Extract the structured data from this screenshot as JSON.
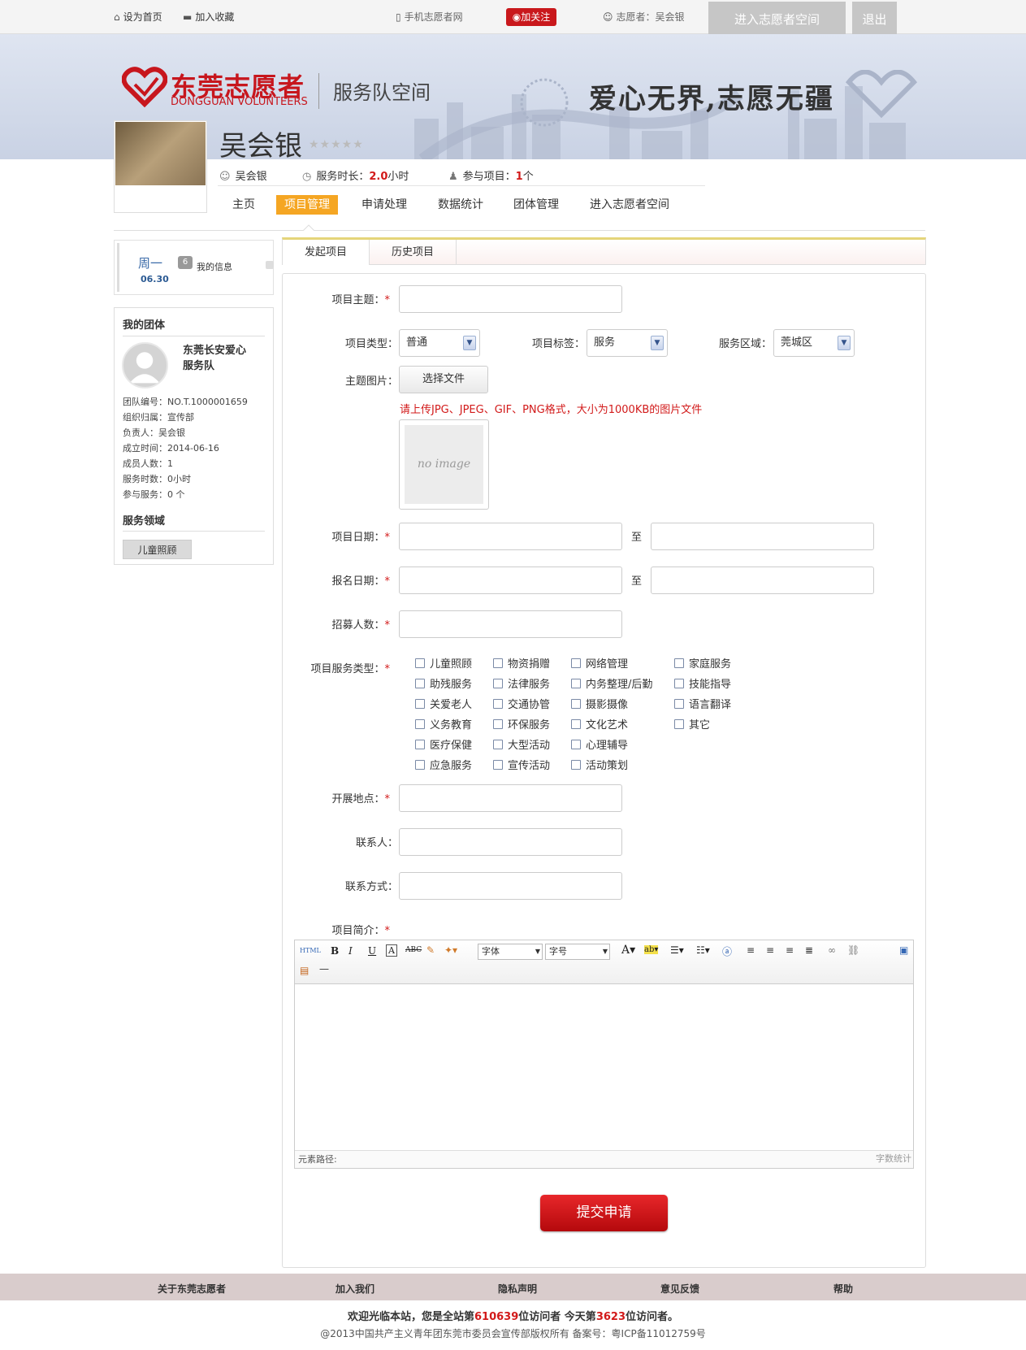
{
  "topbar": {
    "set_home": "设为首页",
    "add_favorite": "加入收藏",
    "mobile_site": "手机志愿者网",
    "weibo_follow": "加关注",
    "volunteer_label": "志愿者：吴会银",
    "enter_space": "进入志愿者空间",
    "logout": "退出"
  },
  "banner": {
    "logo_cn": "东莞志愿者",
    "logo_en": "DONGGUAN VOLUNTEERS",
    "subtitle": "服务队空间",
    "slogan": "爱心无界,志愿无疆"
  },
  "profile": {
    "name": "吴会银",
    "rating_stars": 5,
    "username": "吴会银",
    "service_hours_label": "服务时长：",
    "service_hours_value": "2.0",
    "service_hours_unit": "小时",
    "projects_label": "参与项目：",
    "projects_value": "1",
    "projects_unit": "个"
  },
  "nav": {
    "tabs": [
      {
        "label": "主页"
      },
      {
        "label": "项目管理"
      },
      {
        "label": "申请处理"
      },
      {
        "label": "数据统计"
      },
      {
        "label": "团体管理"
      },
      {
        "label": "进入志愿者空间"
      }
    ],
    "active_index": 1
  },
  "date_card": {
    "weekday": "周一",
    "date": "06.30",
    "message_count": "6",
    "my_info": "我的信息"
  },
  "team": {
    "title": "我的团体",
    "name": "东莞长安爱心服务队",
    "name_line1": "东莞长安爱心",
    "name_line2": "服务队",
    "info": [
      "团队编号：NO.T.1000001659",
      "组织归属：宣传部",
      "负责人：吴会银",
      "成立时间：2014-06-16",
      "成员人数：1",
      "服务时数：0小时",
      "参与服务：0 个"
    ],
    "service_area_title": "服务领域",
    "service_area_tag": "儿童照顾"
  },
  "subtabs": [
    "发起项目",
    "历史项目"
  ],
  "form": {
    "subject_label": "项目主题：",
    "type_label": "项目类型：",
    "type_value": "普通",
    "tag_label": "项目标签：",
    "tag_value": "服务",
    "area_label": "服务区域：",
    "area_value": "莞城区",
    "image_label": "主题图片：",
    "file_button": "选择文件",
    "file_hint": "请上传JPG、JPEG、GIF、PNG格式，大小为1000KB的图片文件",
    "no_image": "no image",
    "project_date_label": "项目日期：",
    "signup_date_label": "报名日期：",
    "to": "至",
    "recruit_label": "招募人数：",
    "service_types_label": "项目服务类型：",
    "service_types": [
      [
        "儿童照顾",
        "物资捐赠",
        "网络管理",
        "家庭服务"
      ],
      [
        "助残服务",
        "法律服务",
        "内务整理/后勤",
        "技能指导"
      ],
      [
        "关爱老人",
        "交通协管",
        "摄影摄像",
        "语言翻译"
      ],
      [
        "义务教育",
        "环保服务",
        "文化艺术",
        "其它"
      ],
      [
        "医疗保健",
        "大型活动",
        "心理辅导"
      ],
      [
        "应急服务",
        "宣传活动",
        "活动策划"
      ]
    ],
    "location_label": "开展地点：",
    "contact_label": "联系人：",
    "contact_method_label": "联系方式：",
    "intro_label": "项目简介：",
    "required_mark": "*",
    "submit": "提交申请"
  },
  "editor": {
    "font_select": "字体",
    "size_select": "字号",
    "path_label": "元素路径:",
    "count_label": "字数统计"
  },
  "footer": {
    "links": [
      "关于东莞志愿者",
      "加入我们",
      "隐私声明",
      "意见反馈",
      "帮助"
    ],
    "welcome_prefix": "欢迎光临本站，您是全站第",
    "total_visitors": "610639",
    "welcome_mid": "位访问者 今天第",
    "today_visitors": "3623",
    "welcome_suffix": "位访问者。",
    "copyright": "@2013中国共产主义青年团东莞市委员会宣传部版权所有  备案号：粤ICP备11012759号"
  },
  "colors": {
    "brand_red": "#c7161d",
    "accent_orange": "#f5a623",
    "required_red": "#d21a1a"
  }
}
